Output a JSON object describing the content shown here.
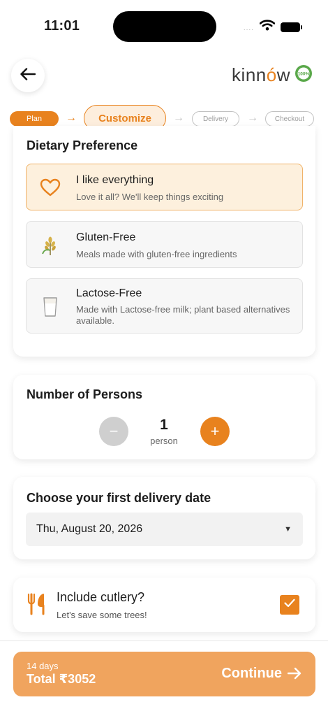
{
  "status_bar": {
    "time": "11:01",
    "signal_dots": "....",
    "wifi_icon": "wifi-icon",
    "battery_icon": "battery-icon"
  },
  "header": {
    "back_icon": "arrow-left-icon",
    "brand_prefix": "kinn",
    "brand_accent": "ó",
    "brand_suffix": "w",
    "badge_text": "100%"
  },
  "stepper": {
    "steps": [
      {
        "label": "Plan",
        "state": "done"
      },
      {
        "label": "Customize",
        "state": "current"
      },
      {
        "label": "Delivery",
        "state": "upcoming"
      },
      {
        "label": "Checkout",
        "state": "upcoming"
      }
    ],
    "arrow_glyph": "→"
  },
  "dietary": {
    "title": "Dietary Preference",
    "options": [
      {
        "title": "I like everything",
        "description": "Love it all? We'll keep things exciting",
        "icon": "heart-icon",
        "selected": true
      },
      {
        "title": "Gluten-Free",
        "description": "Meals made with gluten-free ingredients",
        "icon": "wheat-icon",
        "selected": false
      },
      {
        "title": "Lactose-Free",
        "description": "Made with Lactose-free milk; plant based alternatives available.",
        "icon": "milk-glass-icon",
        "selected": false
      }
    ]
  },
  "persons": {
    "title": "Number of Persons",
    "count": "1",
    "unit": "person",
    "minus": "−",
    "plus": "+"
  },
  "delivery_date": {
    "title": "Choose your first delivery date",
    "value": "Thu, August 20, 2026",
    "caret": "▼"
  },
  "cutlery": {
    "title": "Include cutlery?",
    "subtitle": "Let's save some trees!",
    "checked": true
  },
  "footer": {
    "days": "14 days",
    "total": "Total ₹3052",
    "continue_label": "Continue"
  },
  "colors": {
    "accent": "#e8821e",
    "accent_light": "#fdeedd",
    "continue_bg": "#f0a45e",
    "brand_green": "#5aa84a"
  }
}
